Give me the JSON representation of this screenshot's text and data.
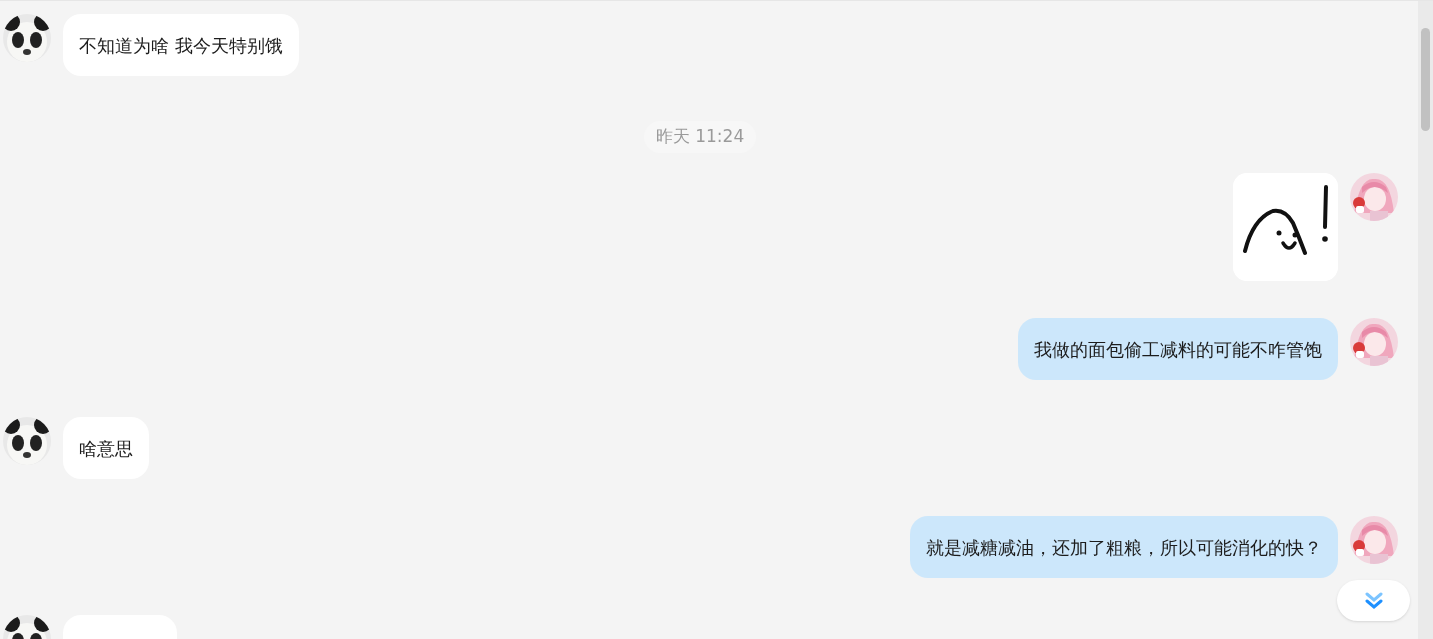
{
  "messages": [
    {
      "kind": "text",
      "outgoing": false,
      "text": "不知道为啥 我今天特别饿"
    },
    {
      "kind": "time",
      "text": "昨天 11:24"
    },
    {
      "kind": "sticker",
      "outgoing": true
    },
    {
      "kind": "text",
      "outgoing": true,
      "text": "我做的面包偷工减料的可能不咋管饱"
    },
    {
      "kind": "text",
      "outgoing": false,
      "text": "啥意思"
    },
    {
      "kind": "text",
      "outgoing": true,
      "text": "就是减糖减油，还加了粗粮，所以可能消化的快？"
    },
    {
      "kind": "text",
      "outgoing": false
    }
  ]
}
